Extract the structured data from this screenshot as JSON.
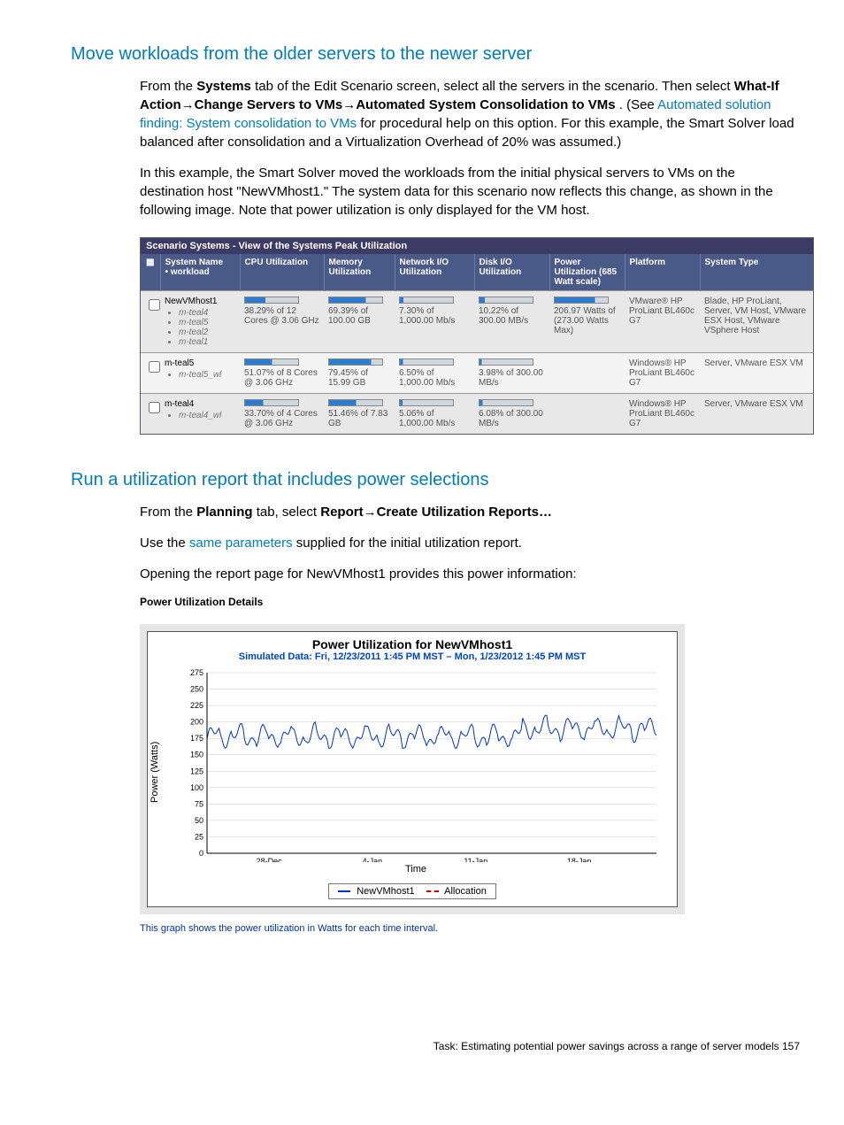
{
  "h1": "Move workloads from the older servers to the newer server",
  "p1a": "From the ",
  "p1b": "Systems",
  "p1c": " tab of the Edit Scenario screen, select all the servers in the scenario. Then select ",
  "p1d": "What-If Action→Change Servers to VMs→Automated System Consolidation to VMs",
  "p1e": ". (See ",
  "p1link": "Automated solution finding: System consolidation to VMs",
  "p1f": " for procedural help on this option. For this example, the Smart Solver load balanced after consolidation and a Virtualization Overhead of 20% was assumed.)",
  "p2": "In this example, the Smart Solver moved the workloads from the initial physical servers to VMs on the destination host \"NewVMhost1.\" The system data for this scenario now reflects this change, as shown in the following image. Note that power utilization is only displayed for the VM host.",
  "scenario_title": "Scenario Systems - View of the Systems Peak Utilization",
  "cols": {
    "c1": "System Name",
    "c1b": "• workload",
    "c2": "CPU Utilization",
    "c3": "Memory Utilization",
    "c4": "Network I/O Utilization",
    "c5": "Disk I/O Utilization",
    "c6": "Power Utilization (685 Watt scale)",
    "c7": "Platform",
    "c8": "System Type"
  },
  "rows": [
    {
      "name": "NewVMhost1",
      "wl": [
        "m-teal4",
        "m-teal5",
        "m-teal2",
        "m-teal1"
      ],
      "cpu": "38.29% of 12 Cores @ 3.06 GHz",
      "mem": "69.39% of 100.00 GB",
      "net": "7.30% of 1,000.00 Mb/s",
      "disk": "10.22% of 300.00 MB/s",
      "pwr": "206.97 Watts of (273.00 Watts Max)",
      "plat": "VMware® HP ProLiant BL460c G7",
      "type": "Blade, HP ProLiant, Server, VM Host, VMware ESX Host, VMware VSphere Host"
    },
    {
      "name": "m-teal5",
      "wl": [
        "m-teal5_wl"
      ],
      "cpu": "51.07% of 8 Cores @ 3.06 GHz",
      "mem": "79.45% of 15.99 GB",
      "net": "6.50% of 1,000.00 Mb/s",
      "disk": "3.98% of 300.00 MB/s",
      "pwr": "",
      "plat": "Windows® HP ProLiant BL460c G7",
      "type": "Server, VMware ESX VM"
    },
    {
      "name": "m-teal4",
      "wl": [
        "m-teal4_wl"
      ],
      "cpu": "33.70% of 4 Cores @ 3.06 GHz",
      "mem": "51.46% of 7.83 GB",
      "net": "5.06% of 1,000.00 Mb/s",
      "disk": "6.08% of 300.00 MB/s",
      "pwr": "",
      "plat": "Windows® HP ProLiant BL460c G7",
      "type": "Server, VMware ESX VM"
    }
  ],
  "h2": "Run a utilization report that includes power selections",
  "p3a": "From the ",
  "p3b": "Planning",
  "p3c": " tab, select ",
  "p3d": "Report→Create Utilization Reports…",
  "p4a": "Use the ",
  "p4link": "same parameters",
  "p4b": " supplied for the initial utilization report.",
  "p5": "Opening the report page for NewVMhost1 provides this power information:",
  "power_label": "Power Utilization Details",
  "chart": {
    "title": "Power Utilization for NewVMhost1",
    "subtitle": "Simulated Data: Fri, 12/23/2011 1:45 PM MST – Mon, 1/23/2012 1:45 PM MST",
    "ylabel": "Power (Watts)",
    "xlabel": "Time",
    "legend1": "NewVMhost1",
    "legend2": "Allocation"
  },
  "chart_data": {
    "type": "line",
    "xticks": [
      "28-Dec",
      "4-Jan",
      "11-Jan",
      "18-Jan"
    ],
    "ylim": [
      0,
      275
    ],
    "yticks": [
      0,
      25,
      50,
      75,
      100,
      125,
      150,
      175,
      200,
      225,
      250,
      275
    ],
    "series": [
      {
        "name": "NewVMhost1",
        "approx_range": [
          160,
          200
        ],
        "approx_mean": 178
      },
      {
        "name": "Allocation",
        "approx_value": null
      }
    ],
    "title": "Power Utilization for NewVMhost1",
    "xlabel": "Time",
    "ylabel": "Power (Watts)"
  },
  "caption": "This graph shows the power utilization in Watts for each time interval.",
  "footer": "Task: Estimating potential power savings across a range of server models   157"
}
